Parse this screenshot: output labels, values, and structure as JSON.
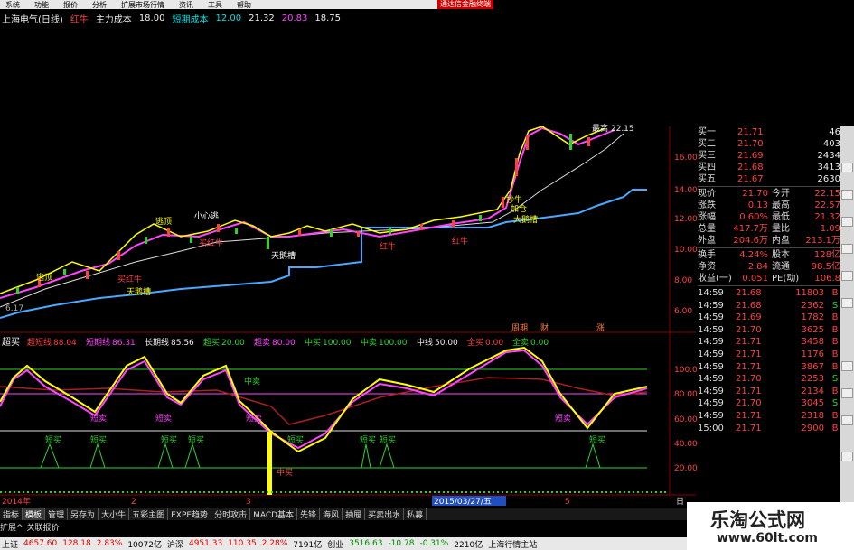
{
  "menubar": {
    "items": [
      "系统",
      "功能",
      "报价",
      "分析",
      "扩展市场行情",
      "资讯",
      "工具",
      "帮助"
    ],
    "badge": "通达信金融终端"
  },
  "infobar": {
    "stock": "上海电气(日线)",
    "redcow": "红牛",
    "cost_label": "主力成本",
    "cost": "18.00",
    "short_label": "短期成本",
    "v1": "12.00",
    "v2": "21.32",
    "v3": "20.83",
    "v4": "18.75"
  },
  "colors": {
    "up": "#ff4040",
    "down": "#2fd22f",
    "cyan": "#00e0e0",
    "magenta": "#ff44ff",
    "yellow": "#ffff00",
    "blue": "#4aa8ff"
  },
  "price_axis": [
    "16.00",
    "14.00",
    "12.00",
    "10.00",
    "8.00",
    "6.00"
  ],
  "upper_marks": {
    "top_label": "最高 22.15",
    "low_label": "6.17",
    "tags": [
      "逃顶",
      "逃顶",
      "小心逃",
      "买红牛",
      "买红牛",
      "天鹅槽",
      "红牛",
      "天鹅槽",
      "抄牛",
      "加仓",
      "大鹅槽",
      "红牛"
    ]
  },
  "indicator": {
    "title": "超买",
    "items": [
      {
        "label": "超短线",
        "value": "88.04",
        "color": "#ff4040"
      },
      {
        "label": "短期线",
        "value": "86.31",
        "color": "#ff44ff"
      },
      {
        "label": "长期线",
        "value": "85.56",
        "color": "#eeeeee"
      },
      {
        "label": "超买",
        "value": "20.00",
        "color": "#2fd22f"
      },
      {
        "label": "超卖",
        "value": "80.00",
        "color": "#ff44ff"
      },
      {
        "label": "中买",
        "value": "100.00",
        "color": "#2fd22f"
      },
      {
        "label": "中卖",
        "value": "100.00",
        "color": "#2fd22f"
      },
      {
        "label": "中线",
        "value": "50.00",
        "color": "#eeeeee"
      },
      {
        "label": "全买",
        "value": "0.00",
        "color": "#ff4040"
      },
      {
        "label": "全卖",
        "value": "0.00",
        "color": "#2fd22f"
      }
    ]
  },
  "period_labels": [
    "周期",
    "财",
    "涨"
  ],
  "indicator_axis": [
    "100.00",
    "80.00",
    "60.00",
    "40.00",
    "20.00"
  ],
  "ind_tags": {
    "sell": "短卖",
    "buy": "短买",
    "mid_sell": "中卖",
    "mid_buy": "中买"
  },
  "date_axis": {
    "left": "2014年",
    "m2": "2",
    "m3": "3",
    "highlight": "2015/03/27/五",
    "m5": "5",
    "right": "日"
  },
  "quote": {
    "bids": [
      {
        "label": "买一",
        "price": "21.71",
        "vol": "46"
      },
      {
        "label": "买二",
        "price": "21.70",
        "vol": "403"
      },
      {
        "label": "买三",
        "price": "21.69",
        "vol": "2434"
      },
      {
        "label": "买四",
        "price": "21.68",
        "vol": "3413"
      },
      {
        "label": "买五",
        "price": "21.67",
        "vol": "2630"
      }
    ],
    "stats": [
      {
        "l1": "现价",
        "v1": "21.70",
        "l2": "今开",
        "v2": "22.15"
      },
      {
        "l1": "涨跌",
        "v1": "0.13",
        "l2": "最高",
        "v2": "22.57"
      },
      {
        "l1": "涨幅",
        "v1": "0.60%",
        "l2": "最低",
        "v2": "21.32"
      },
      {
        "l1": "总量",
        "v1": "417.7万",
        "l2": "量比",
        "v2": "1.09"
      },
      {
        "l1": "外盘",
        "v1": "204.6万",
        "l2": "内盘",
        "v2": "213.1万"
      }
    ],
    "stats2": [
      {
        "l1": "换手",
        "v1": "4.24%",
        "l2": "股本",
        "v2": "128亿"
      },
      {
        "l1": "净资",
        "v1": "2.84",
        "l2": "流通",
        "v2": "98.5亿"
      },
      {
        "l1": "收益(一)",
        "v1": "0.051",
        "l2": "PE(动)",
        "v2": "106.8"
      }
    ]
  },
  "ticks": [
    {
      "time": "14:59",
      "price": "21.68",
      "vol": "11803",
      "bs": "B"
    },
    {
      "time": "14:59",
      "price": "21.68",
      "vol": "2362",
      "bs": "S"
    },
    {
      "time": "14:59",
      "price": "21.69",
      "vol": "1782",
      "bs": "B"
    },
    {
      "time": "14:59",
      "price": "21.70",
      "vol": "3625",
      "bs": "B"
    },
    {
      "time": "14:59",
      "price": "21.71",
      "vol": "3458",
      "bs": "B"
    },
    {
      "time": "14:59",
      "price": "21.71",
      "vol": "1176",
      "bs": "B"
    },
    {
      "time": "14:59",
      "price": "21.71",
      "vol": "3867",
      "bs": "B"
    },
    {
      "time": "14:59",
      "price": "21.70",
      "vol": "2253",
      "bs": "S"
    },
    {
      "time": "14:59",
      "price": "21.71",
      "vol": "2134",
      "bs": "B"
    },
    {
      "time": "14:59",
      "price": "21.70",
      "vol": "3045",
      "bs": "S"
    },
    {
      "time": "14:59",
      "price": "21.71",
      "vol": "2318",
      "bs": "B"
    },
    {
      "time": "15:00",
      "price": "21.71",
      "vol": "2900",
      "bs": "B"
    }
  ],
  "tabs": [
    "指标",
    "模板",
    "管理",
    "另存为",
    "大小牛",
    "五彩主图",
    "EXPE趋势",
    "分时攻击",
    "MACD基本",
    "先锋",
    "海风",
    "抽屉",
    "买卖出水",
    "私募"
  ],
  "subtabs": [
    "扩展^",
    "关联报价"
  ],
  "status": [
    {
      "text": "上证",
      "color": "#000"
    },
    {
      "text": "4657.60",
      "color": "#d00"
    },
    {
      "text": "128.18",
      "color": "#d00"
    },
    {
      "text": "2.83%",
      "color": "#d00"
    },
    {
      "text": "10072亿",
      "color": "#000"
    },
    {
      "text": "沪深",
      "color": "#000"
    },
    {
      "text": "4951.33",
      "color": "#d00"
    },
    {
      "text": "110.35",
      "color": "#d00"
    },
    {
      "text": "2.28%",
      "color": "#d00"
    },
    {
      "text": "7191亿",
      "color": "#000"
    },
    {
      "text": "创业",
      "color": "#000"
    },
    {
      "text": "3516.63",
      "color": "#080"
    },
    {
      "text": "-10.78",
      "color": "#080"
    },
    {
      "text": "-0.31%",
      "color": "#080"
    },
    {
      "text": "2210亿",
      "color": "#000"
    },
    {
      "text": "上海行情主站",
      "color": "#000"
    }
  ],
  "watermark": {
    "title": "乐淘公式网",
    "url": "www.60lt.com"
  }
}
